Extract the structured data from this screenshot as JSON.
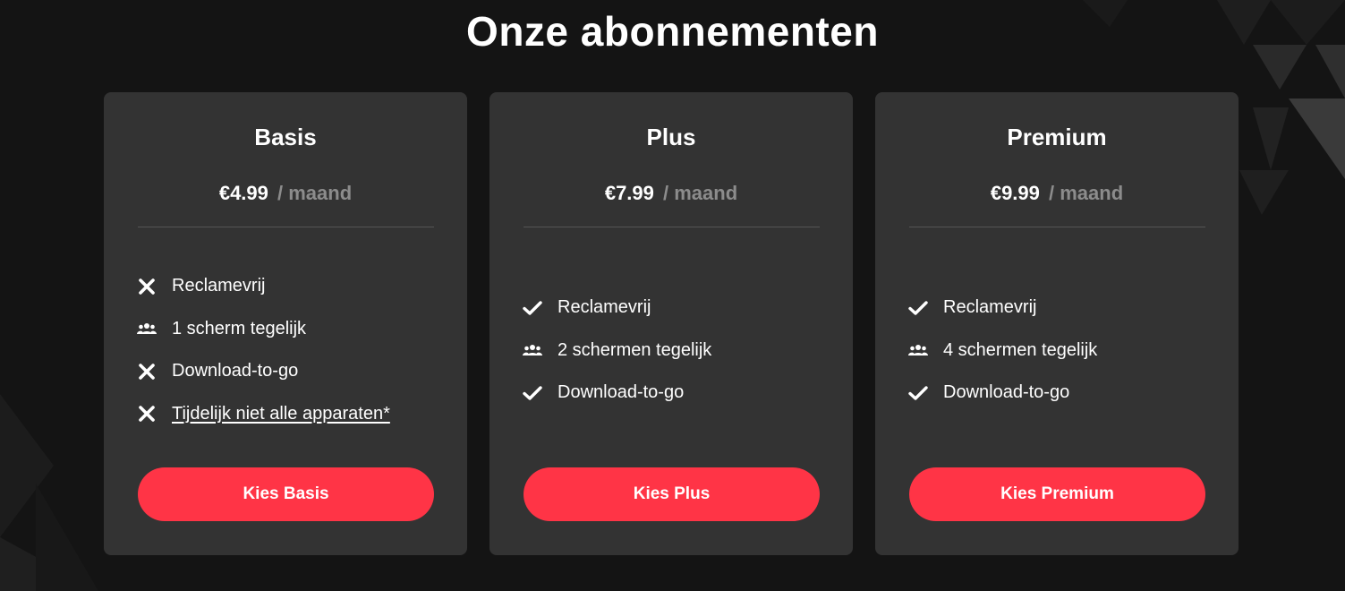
{
  "page": {
    "title": "Onze abonnementen"
  },
  "colors": {
    "background": "#141414",
    "card": "#333333",
    "accent": "#ff3446",
    "muted": "#8c8c8c"
  },
  "plans": [
    {
      "name": "Basis",
      "price": "€4.99",
      "period": "/ maand",
      "features": [
        {
          "icon": "close-icon",
          "label": "Reclamevrij",
          "link": false
        },
        {
          "icon": "users-icon",
          "label": "1 scherm tegelijk",
          "link": false
        },
        {
          "icon": "close-icon",
          "label": "Download-to-go",
          "link": false
        },
        {
          "icon": "close-icon",
          "label": "Tijdelijk niet alle apparaten*",
          "link": true
        }
      ],
      "cta": "Kies Basis"
    },
    {
      "name": "Plus",
      "price": "€7.99",
      "period": "/ maand",
      "features": [
        {
          "icon": "check-icon",
          "label": "Reclamevrij",
          "link": false
        },
        {
          "icon": "users-icon",
          "label": "2 schermen tegelijk",
          "link": false
        },
        {
          "icon": "check-icon",
          "label": "Download-to-go",
          "link": false
        }
      ],
      "cta": "Kies Plus"
    },
    {
      "name": "Premium",
      "price": "€9.99",
      "period": "/ maand",
      "features": [
        {
          "icon": "check-icon",
          "label": "Reclamevrij",
          "link": false
        },
        {
          "icon": "users-icon",
          "label": "4 schermen tegelijk",
          "link": false
        },
        {
          "icon": "check-icon",
          "label": "Download-to-go",
          "link": false
        }
      ],
      "cta": "Kies Premium"
    }
  ]
}
